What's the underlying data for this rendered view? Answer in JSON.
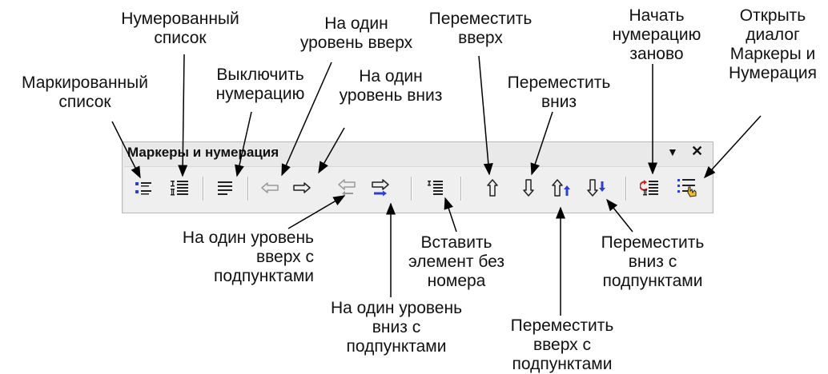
{
  "toolbar": {
    "title": "Маркеры и нумерация",
    "menu_glyph": "▼",
    "close_glyph": "✕",
    "buttons": [
      {
        "name": "bulleted-list",
        "icon": "bulleted-list-icon"
      },
      {
        "name": "numbered-list",
        "icon": "numbered-list-icon"
      },
      {
        "name": "numbering-off",
        "icon": "align-left-icon"
      },
      {
        "name": "promote-one-level",
        "icon": "arrow-left-outline-icon"
      },
      {
        "name": "demote-one-level",
        "icon": "arrow-right-outline-icon"
      },
      {
        "name": "promote-with-subpoints",
        "icon": "arrow-left-double-icon"
      },
      {
        "name": "demote-with-subpoints",
        "icon": "arrow-right-double-icon"
      },
      {
        "name": "insert-unnumbered-entry",
        "icon": "unnumbered-entry-icon"
      },
      {
        "name": "move-up",
        "icon": "arrow-up-outline-icon"
      },
      {
        "name": "move-down",
        "icon": "arrow-down-outline-icon"
      },
      {
        "name": "move-up-with-subpoints",
        "icon": "arrow-up-double-icon"
      },
      {
        "name": "move-down-with-subpoints",
        "icon": "arrow-down-double-icon"
      },
      {
        "name": "restart-numbering",
        "icon": "restart-numbering-icon"
      },
      {
        "name": "bullets-and-numbering-dialog",
        "icon": "bullets-dialog-icon"
      }
    ]
  },
  "labels": {
    "bulleted_list": "Маркированный\nсписок",
    "numbered_list": "Нумерованный\nсписок",
    "numbering_off": "Выключить\nнумерацию",
    "promote": "На один\nуровень вверх",
    "demote": "На один\nуровень вниз",
    "move_up": "Переместить\nвверх",
    "move_down": "Переместить\nвниз",
    "restart_numbering": "Начать\nнумерацию\nзаново",
    "open_dialog": "Открыть\nдиалог\nМаркеры и\nНумерация",
    "promote_sub": "На один уровень\nвверх с\nподпунктами",
    "demote_sub": "На один уровень\nвниз с\nподпунктами",
    "insert_unnumbered": "Вставить\nэлемент без\nномера",
    "move_down_sub": "Переместить\nвниз с\nподпунктами",
    "move_up_sub": "Переместить\nвверх с\nподпунктами"
  },
  "colors": {
    "accent_blue": "#2a3fd8",
    "accent_red": "#d02020",
    "icon_gray": "#9a9a9a",
    "icon_dark": "#222222"
  }
}
